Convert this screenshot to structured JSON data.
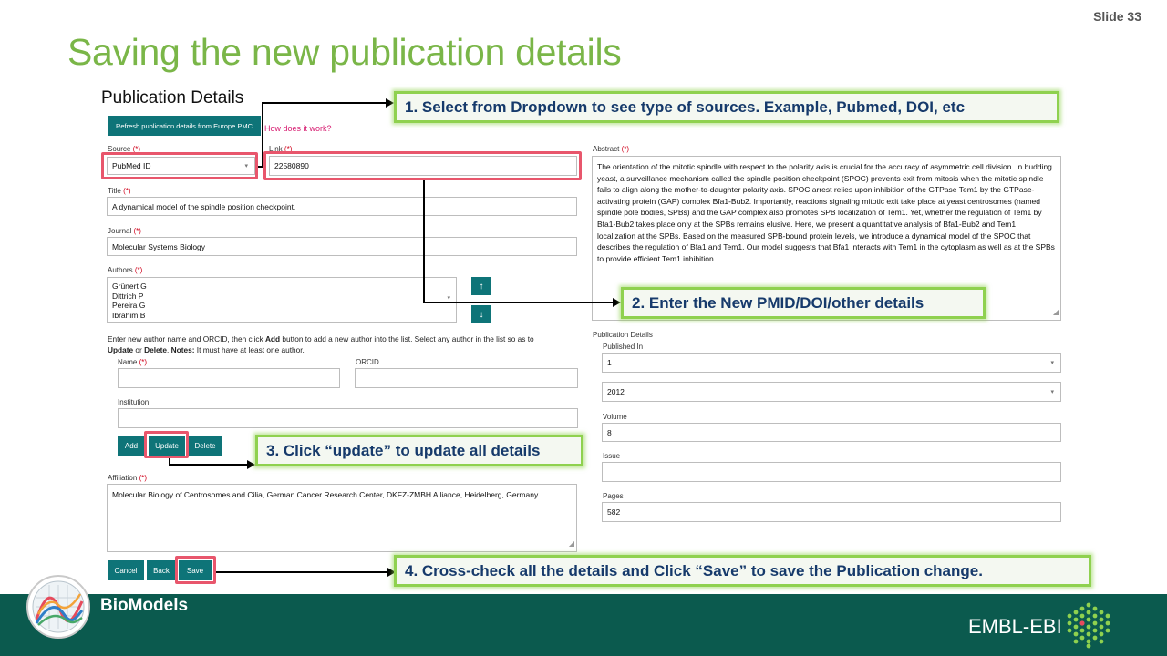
{
  "slide_number": "Slide 33",
  "title": "Saving the new publication details",
  "form": {
    "section_title": "Publication Details",
    "refresh_button": "Refresh publication details from Europe PMC",
    "how_link": "How does it work?",
    "source_label": "Source",
    "source_value": "PubMed ID",
    "link_label": "Link",
    "link_value": "22580890",
    "required_mark": "(*)",
    "title_label": "Title",
    "title_value": "A dynamical model of the spindle position checkpoint.",
    "journal_label": "Journal",
    "journal_value": "Molecular Systems Biology",
    "authors_label": "Authors",
    "authors": [
      "Grünert G",
      "Dittrich P",
      "Pereira G",
      "Ibrahim B"
    ],
    "author_instr_1": "Enter new author name and ORCID, then click ",
    "author_instr_add": "Add",
    "author_instr_2": " button to add a new author into the list. Select any author in the list so as to",
    "author_instr_update": "Update",
    "author_instr_or": " or ",
    "author_instr_delete": "Delete",
    "author_instr_notes": "Notes:",
    "author_instr_3": " It must have at least one author.",
    "name_label": "Name",
    "orcid_label": "ORCID",
    "institution_label": "Institution",
    "add_button": "Add",
    "update_button": "Update",
    "delete_button": "Delete",
    "affiliation_label": "Affiliation",
    "affiliation_value": "Molecular Biology of Centrosomes and Cilia, German Cancer Research Center, DKFZ-ZMBH Alliance, Heidelberg, Germany.",
    "cancel_button": "Cancel",
    "back_button": "Back",
    "save_button": "Save",
    "abstract_label": "Abstract",
    "abstract_value": "The orientation of the mitotic spindle with respect to the polarity axis is crucial for the accuracy of asymmetric cell division. In budding yeast, a surveillance mechanism called the spindle position checkpoint (SPOC) prevents exit from mitosis when the mitotic spindle fails to align along the mother-to-daughter polarity axis. SPOC arrest relies upon inhibition of the GTPase Tem1 by the GTPase-activating protein (GAP) complex Bfa1-Bub2. Importantly, reactions signaling mitotic exit take place at yeast centrosomes (named spindle pole bodies, SPBs) and the GAP complex also promotes SPB localization of Tem1. Yet, whether the regulation of Tem1 by Bfa1-Bub2 takes place only at the SPBs remains elusive. Here, we present a quantitative analysis of Bfa1-Bub2 and Tem1 localization at the SPBs. Based on the measured SPB-bound protein levels, we introduce a dynamical model of the SPOC that describes the regulation of Bfa1 and Tem1. Our model suggests that Bfa1 interacts with Tem1 in the cytoplasm as well as at the SPBs to provide efficient Tem1 inhibition.",
    "pub_details_label": "Publication Details",
    "published_in_label": "Published In",
    "month_value": "1",
    "year_value": "2012",
    "volume_label": "Volume",
    "volume_value": "8",
    "issue_label": "Issue",
    "issue_value": "",
    "pages_label": "Pages",
    "pages_value": "582"
  },
  "callouts": {
    "c1": "1. Select from Dropdown to see type of sources. Example, Pubmed, DOI, etc",
    "c2": "2. Enter the New PMID/DOI/other details",
    "c3": "3. Click “update” to update all details",
    "c4": "4. Cross-check all the details and Click “Save” to save the Publication change."
  },
  "footer": {
    "brand": "BioModels",
    "org": "EMBL-EBI"
  },
  "colors": {
    "title_green": "#7ab648",
    "teal_button": "#0e7478",
    "footer_bg": "#0b5a4e",
    "highlight_red": "#e8566c",
    "callout_border": "#8fd14f",
    "callout_text": "#163a6b"
  }
}
